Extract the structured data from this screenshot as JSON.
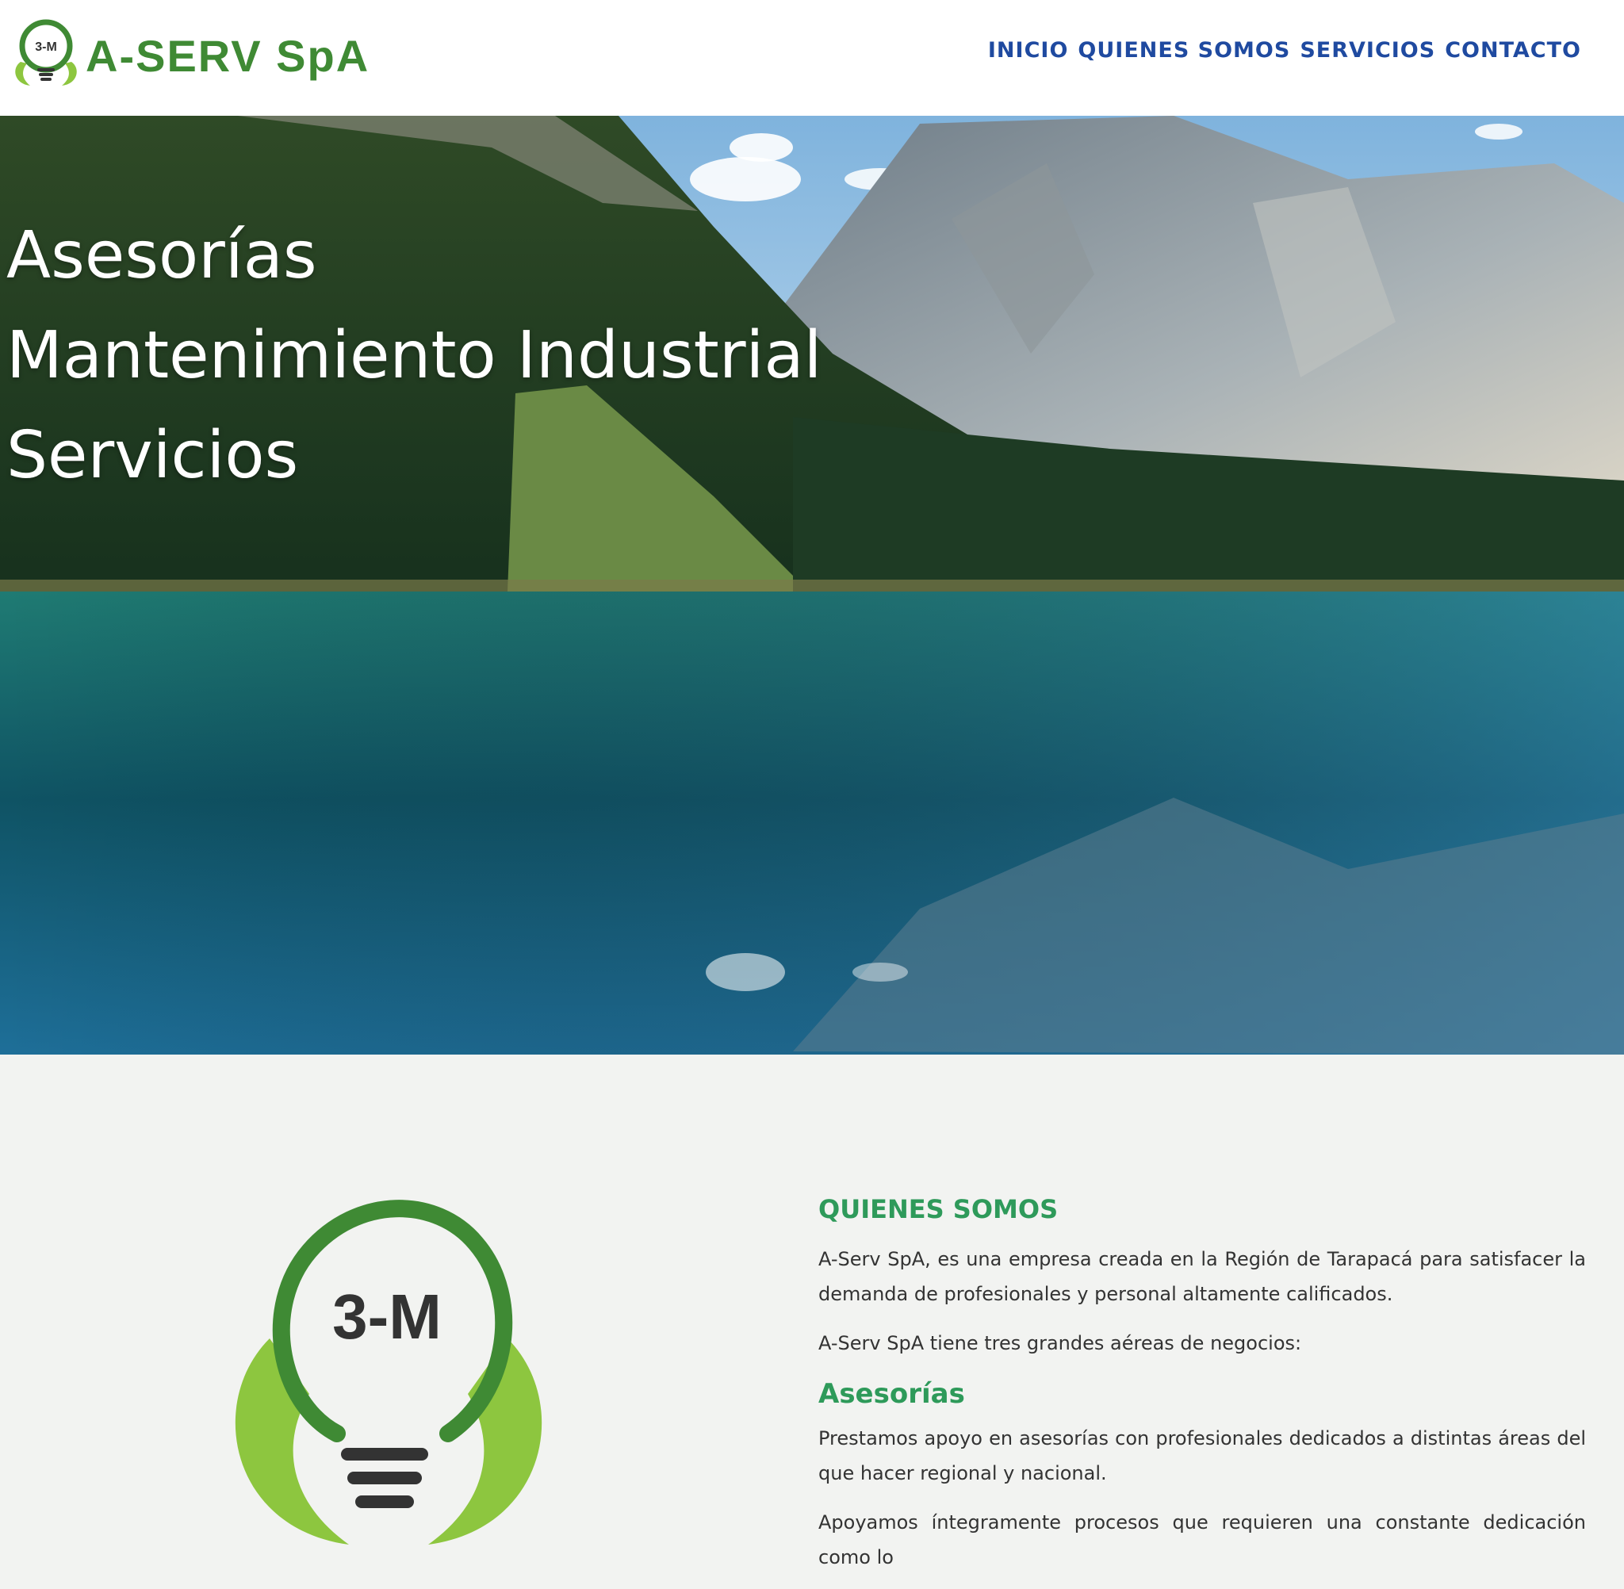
{
  "header": {
    "logo_badge": "3-M",
    "brand": "A-SERV SpA",
    "nav": [
      {
        "label": "INICIO"
      },
      {
        "label": "QUIENES SOMOS"
      },
      {
        "label": "SERVICIOS"
      },
      {
        "label": "CONTACTO"
      }
    ]
  },
  "hero": {
    "lines": [
      "Asesorías",
      "Mantenimiento Industrial",
      "Servicios"
    ]
  },
  "about": {
    "logo_text": "3-M",
    "title": "QUIENES SOMOS",
    "p1": "A-Serv SpA, es una empresa creada en la Región de Tarapacá para satisfacer la demanda de profesionales y personal altamente calificados.",
    "p2": "A-Serv SpA tiene tres grandes aéreas de negocios:",
    "sub_title": "Asesorías",
    "p3": "Prestamos apoyo en asesorías con profesionales dedicados a distintas áreas del que hacer regional y nacional.",
    "p4": "Apoyamos íntegramente procesos que requieren una constante dedicación como lo"
  },
  "colors": {
    "brand_green": "#3f8a34",
    "nav_blue": "#1f4aa0",
    "heading_green": "#2e9a5a",
    "leaf_light": "#8dc63f"
  }
}
